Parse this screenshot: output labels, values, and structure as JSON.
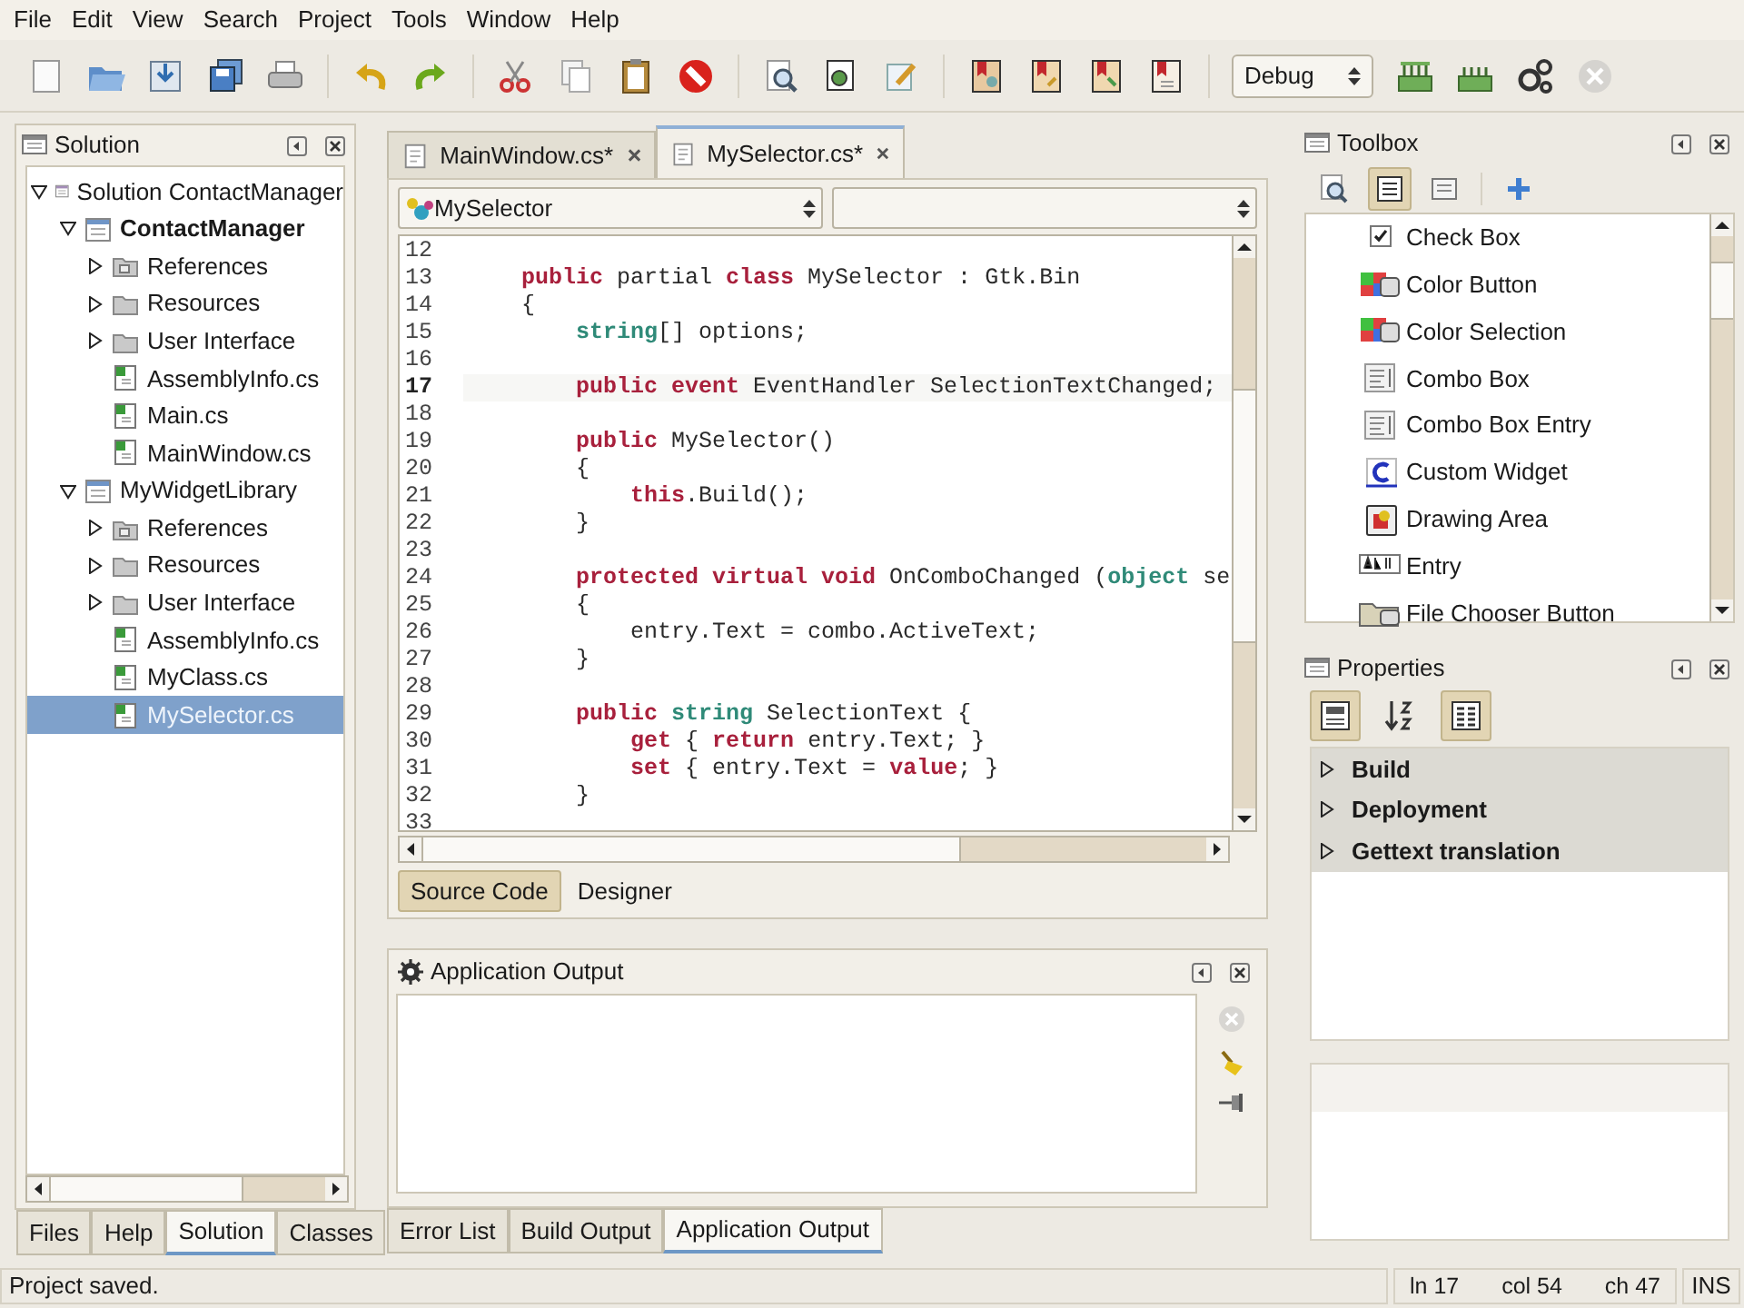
{
  "menu": [
    "File",
    "Edit",
    "View",
    "Search",
    "Project",
    "Tools",
    "Window",
    "Help"
  ],
  "toolbar": {
    "configuration": "Debug"
  },
  "solution_pad": {
    "title": "Solution",
    "tree": [
      {
        "label": "Solution ContactManager",
        "kind": "solution",
        "expanded": true,
        "selected": false,
        "children": [
          {
            "label": "ContactManager",
            "kind": "project",
            "startup": true,
            "expanded": true,
            "selected": false,
            "children": [
              {
                "label": "References",
                "kind": "references",
                "expanded": false,
                "selected": false
              },
              {
                "label": "Resources",
                "kind": "folder",
                "expanded": false,
                "selected": false
              },
              {
                "label": "User Interface",
                "kind": "folder",
                "expanded": false,
                "selected": false
              },
              {
                "label": "AssemblyInfo.cs",
                "kind": "file",
                "selected": false
              },
              {
                "label": "Main.cs",
                "kind": "file",
                "selected": false
              },
              {
                "label": "MainWindow.cs",
                "kind": "file",
                "selected": false
              }
            ]
          },
          {
            "label": "MyWidgetLibrary",
            "kind": "project",
            "startup": false,
            "expanded": true,
            "selected": false,
            "children": [
              {
                "label": "References",
                "kind": "references",
                "expanded": false,
                "selected": false
              },
              {
                "label": "Resources",
                "kind": "folder",
                "expanded": false,
                "selected": false
              },
              {
                "label": "User Interface",
                "kind": "folder",
                "expanded": false,
                "selected": false
              },
              {
                "label": "AssemblyInfo.cs",
                "kind": "file",
                "selected": false
              },
              {
                "label": "MyClass.cs",
                "kind": "file",
                "selected": false
              },
              {
                "label": "MySelector.cs",
                "kind": "file",
                "selected": true
              }
            ]
          }
        ]
      }
    ],
    "tabs": [
      {
        "label": "Files",
        "selected": false
      },
      {
        "label": "Help",
        "selected": false
      },
      {
        "label": "Solution",
        "selected": true
      },
      {
        "label": "Classes",
        "selected": false
      }
    ]
  },
  "editor": {
    "tabs": [
      {
        "label": "MainWindow.cs*",
        "selected": false
      },
      {
        "label": "MySelector.cs*",
        "selected": true
      }
    ],
    "class_combo": "MySelector",
    "lines": [
      {
        "number": "12",
        "current": false
      },
      {
        "number": "13",
        "current": false,
        "tokens": [
          {
            "kind": "keyword",
            "text": "    public"
          },
          {
            "kind": "plain",
            "text": " partial "
          },
          {
            "kind": "keyword",
            "text": "class"
          },
          {
            "kind": "plain",
            "text": " MySelector : Gtk.Bin"
          }
        ]
      },
      {
        "number": "14",
        "current": false,
        "tokens": [
          {
            "kind": "plain",
            "text": "    {"
          }
        ]
      },
      {
        "number": "15",
        "current": false,
        "tokens": [
          {
            "kind": "type",
            "text": "        string"
          },
          {
            "kind": "plain",
            "text": "[] options;"
          }
        ]
      },
      {
        "number": "16",
        "current": false
      },
      {
        "number": "17",
        "current": true,
        "tokens": [
          {
            "kind": "keyword",
            "text": "        public event"
          },
          {
            "kind": "plain",
            "text": " EventHandler SelectionTextChanged;"
          }
        ]
      },
      {
        "number": "18",
        "current": false
      },
      {
        "number": "19",
        "current": false,
        "tokens": [
          {
            "kind": "keyword",
            "text": "        public"
          },
          {
            "kind": "plain",
            "text": " MySelector()"
          }
        ]
      },
      {
        "number": "20",
        "current": false,
        "tokens": [
          {
            "kind": "plain",
            "text": "        {"
          }
        ]
      },
      {
        "number": "21",
        "current": false,
        "tokens": [
          {
            "kind": "keyword",
            "text": "            this"
          },
          {
            "kind": "plain",
            "text": ".Build();"
          }
        ]
      },
      {
        "number": "22",
        "current": false,
        "tokens": [
          {
            "kind": "plain",
            "text": "        }"
          }
        ]
      },
      {
        "number": "23",
        "current": false
      },
      {
        "number": "24",
        "current": false,
        "tokens": [
          {
            "kind": "keyword",
            "text": "        protected virtual void"
          },
          {
            "kind": "plain",
            "text": " OnComboChanged ("
          },
          {
            "kind": "type",
            "text": "object"
          },
          {
            "kind": "plain",
            "text": " se"
          }
        ]
      },
      {
        "number": "25",
        "current": false,
        "tokens": [
          {
            "kind": "plain",
            "text": "        {"
          }
        ]
      },
      {
        "number": "26",
        "current": false,
        "tokens": [
          {
            "kind": "plain",
            "text": "            entry.Text = combo.ActiveText;"
          }
        ]
      },
      {
        "number": "27",
        "current": false,
        "tokens": [
          {
            "kind": "plain",
            "text": "        }"
          }
        ]
      },
      {
        "number": "28",
        "current": false
      },
      {
        "number": "29",
        "current": false,
        "tokens": [
          {
            "kind": "keyword",
            "text": "        public"
          },
          {
            "kind": "type",
            "text": " string"
          },
          {
            "kind": "plain",
            "text": " SelectionText {"
          }
        ]
      },
      {
        "number": "30",
        "current": false,
        "tokens": [
          {
            "kind": "keyword",
            "text": "            get"
          },
          {
            "kind": "plain",
            "text": " { "
          },
          {
            "kind": "keyword",
            "text": "return"
          },
          {
            "kind": "plain",
            "text": " entry.Text; }"
          }
        ]
      },
      {
        "number": "31",
        "current": false,
        "tokens": [
          {
            "kind": "keyword",
            "text": "            set"
          },
          {
            "kind": "plain",
            "text": " { entry.Text = "
          },
          {
            "kind": "keyword",
            "text": "value"
          },
          {
            "kind": "plain",
            "text": "; }"
          }
        ]
      },
      {
        "number": "32",
        "current": false,
        "tokens": [
          {
            "kind": "plain",
            "text": "        }"
          }
        ]
      },
      {
        "number": "33",
        "current": false
      }
    ],
    "view_tabs": [
      {
        "label": "Source Code",
        "selected": true
      },
      {
        "label": "Designer",
        "selected": false
      }
    ]
  },
  "output_pad": {
    "title": "Application Output",
    "tabs": [
      {
        "label": "Error List",
        "selected": false
      },
      {
        "label": "Build Output",
        "selected": false
      },
      {
        "label": "Application Output",
        "selected": true
      }
    ]
  },
  "toolbox": {
    "title": "Toolbox",
    "items": [
      {
        "label": "Check Box",
        "kind": "checkbox"
      },
      {
        "label": "Color Button",
        "kind": "color"
      },
      {
        "label": "Color Selection",
        "kind": "color"
      },
      {
        "label": "Combo Box",
        "kind": "combo"
      },
      {
        "label": "Combo Box Entry",
        "kind": "combo"
      },
      {
        "label": "Custom Widget",
        "kind": "custom"
      },
      {
        "label": "Drawing Area",
        "kind": "drawing"
      },
      {
        "label": "Entry",
        "kind": "entry"
      },
      {
        "label": "File Chooser Button",
        "kind": "filechooser"
      }
    ]
  },
  "properties": {
    "title": "Properties",
    "categories": [
      {
        "label": "Build",
        "expanded": false
      },
      {
        "label": "Deployment",
        "expanded": false
      },
      {
        "label": "Gettext translation",
        "expanded": false
      }
    ]
  },
  "status_bar": {
    "message": "Project saved.",
    "line": "ln 17",
    "column": "col 54",
    "char": "ch 47",
    "mode": "INS"
  }
}
